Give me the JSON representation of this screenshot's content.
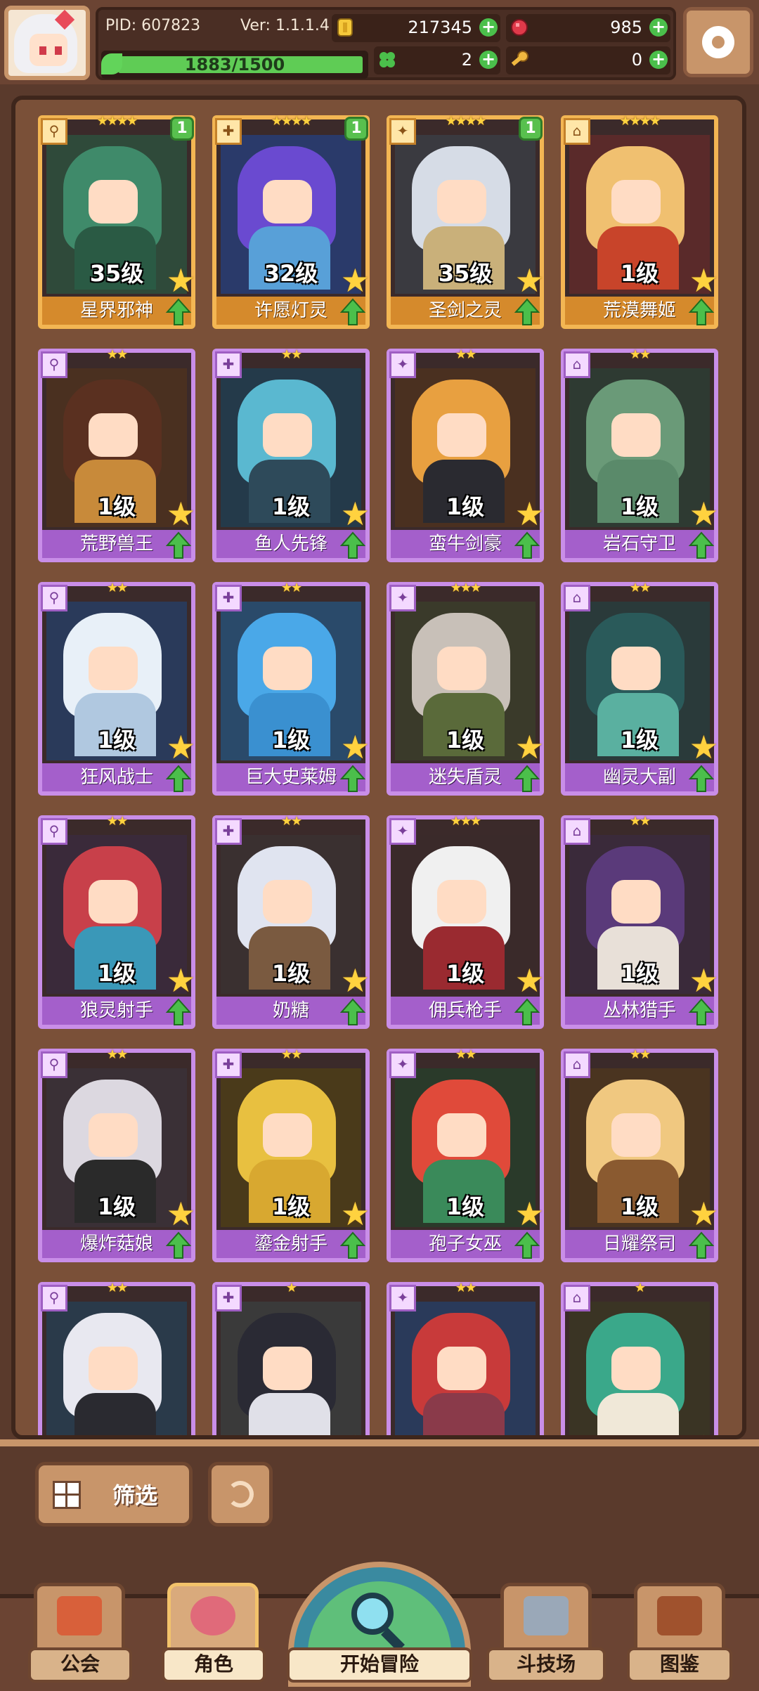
{
  "header": {
    "pid": "PID: 607823",
    "version": "Ver: 1.1.1.4",
    "xp": "1883/1500",
    "gold": "217345",
    "gems": "985",
    "clovers": "2",
    "keys": "0"
  },
  "roster": [
    {
      "name": "星界邪神",
      "level": "35级",
      "stars": "★★★★",
      "rarity": "gold",
      "badge": "1",
      "colors": {
        "bg": "#2f4a3a",
        "hair": "#3f8a6a",
        "body": "#2a5a44"
      }
    },
    {
      "name": "许愿灯灵",
      "level": "32级",
      "stars": "★★★★",
      "rarity": "gold",
      "badge": "1",
      "colors": {
        "bg": "#2a3a6a",
        "hair": "#6a4ad0",
        "body": "#58a0d8"
      }
    },
    {
      "name": "圣剑之灵",
      "level": "35级",
      "stars": "★★★★",
      "rarity": "gold",
      "badge": "1",
      "colors": {
        "bg": "#3a3a40",
        "hair": "#d6dce6",
        "body": "#c9b07a"
      }
    },
    {
      "name": "荒漠舞姬",
      "level": "1级",
      "stars": "★★★★",
      "rarity": "gold",
      "badge": "",
      "colors": {
        "bg": "#5a2a2a",
        "hair": "#f0c070",
        "body": "#c8442a"
      }
    },
    {
      "name": "荒野兽王",
      "level": "1级",
      "stars": "★★",
      "rarity": "purple",
      "badge": "",
      "colors": {
        "bg": "#4a3020",
        "hair": "#5a3020",
        "body": "#c88a3a"
      }
    },
    {
      "name": "鱼人先锋",
      "level": "1级",
      "stars": "★★",
      "rarity": "purple",
      "badge": "",
      "colors": {
        "bg": "#243a4a",
        "hair": "#5ab8d0",
        "body": "#2e4a5a"
      }
    },
    {
      "name": "蛮牛剑豪",
      "level": "1级",
      "stars": "★★",
      "rarity": "purple",
      "badge": "",
      "colors": {
        "bg": "#4a3020",
        "hair": "#e8a040",
        "body": "#2a2a30"
      }
    },
    {
      "name": "岩石守卫",
      "level": "1级",
      "stars": "★★",
      "rarity": "purple",
      "badge": "",
      "colors": {
        "bg": "#2e3a32",
        "hair": "#6a9a78",
        "body": "#5a8a6a"
      }
    },
    {
      "name": "狂风战士",
      "level": "1级",
      "stars": "★★",
      "rarity": "purple",
      "badge": "",
      "colors": {
        "bg": "#2a3a5a",
        "hair": "#e8f0f8",
        "body": "#b0c8e0"
      }
    },
    {
      "name": "巨大史莱姆",
      "level": "1级",
      "stars": "★★",
      "rarity": "purple",
      "badge": "",
      "colors": {
        "bg": "#2a4a6a",
        "hair": "#4aa8e8",
        "body": "#3a90d0"
      }
    },
    {
      "name": "迷失盾灵",
      "level": "1级",
      "stars": "★★★",
      "rarity": "purple",
      "badge": "",
      "colors": {
        "bg": "#3a3a2a",
        "hair": "#c8c0b8",
        "body": "#5a6a3a"
      }
    },
    {
      "name": "幽灵大副",
      "level": "1级",
      "stars": "★★",
      "rarity": "purple",
      "badge": "",
      "colors": {
        "bg": "#2a3a3a",
        "hair": "#2a5a5a",
        "body": "#5ab0a0"
      }
    },
    {
      "name": "狼灵射手",
      "level": "1级",
      "stars": "★★",
      "rarity": "purple",
      "badge": "",
      "colors": {
        "bg": "#3a2a3a",
        "hair": "#c8404a",
        "body": "#3a98b8"
      }
    },
    {
      "name": "奶糖",
      "level": "1级",
      "stars": "★★",
      "rarity": "purple",
      "badge": "",
      "colors": {
        "bg": "#3a3030",
        "hair": "#e0e4f0",
        "body": "#7a5a40"
      }
    },
    {
      "name": "佣兵枪手",
      "level": "1级",
      "stars": "★★★",
      "rarity": "purple",
      "badge": "",
      "colors": {
        "bg": "#3a2a2a",
        "hair": "#f0f0f0",
        "body": "#9a2a30"
      }
    },
    {
      "name": "丛林猎手",
      "level": "1级",
      "stars": "★★",
      "rarity": "purple",
      "badge": "",
      "colors": {
        "bg": "#3a2a3a",
        "hair": "#5a3a7a",
        "body": "#e8e0d8"
      }
    },
    {
      "name": "爆炸菇娘",
      "level": "1级",
      "stars": "★★",
      "rarity": "purple",
      "badge": "",
      "colors": {
        "bg": "#3a3036",
        "hair": "#dcd8e0",
        "body": "#2a2a2a"
      }
    },
    {
      "name": "鎏金射手",
      "level": "1级",
      "stars": "★★",
      "rarity": "purple",
      "badge": "",
      "colors": {
        "bg": "#4a3a1a",
        "hair": "#e8c040",
        "body": "#d8a830"
      }
    },
    {
      "name": "孢子女巫",
      "level": "1级",
      "stars": "★★",
      "rarity": "purple",
      "badge": "",
      "colors": {
        "bg": "#2a3a2a",
        "hair": "#e04a3a",
        "body": "#3a8a5a"
      }
    },
    {
      "name": "日耀祭司",
      "level": "1级",
      "stars": "★★",
      "rarity": "purple",
      "badge": "",
      "colors": {
        "bg": "#4a3420",
        "hair": "#f0c880",
        "body": "#8a5a30"
      }
    },
    {
      "name": "",
      "level": "",
      "stars": "★★",
      "rarity": "purple",
      "badge": "",
      "colors": {
        "bg": "#2a3a4a",
        "hair": "#e8e8f0",
        "body": "#2a2a30"
      }
    },
    {
      "name": "",
      "level": "",
      "stars": "★",
      "rarity": "purple",
      "badge": "",
      "colors": {
        "bg": "#3a3a3a",
        "hair": "#2a2a34",
        "body": "#e0e0e8"
      }
    },
    {
      "name": "",
      "level": "",
      "stars": "★★",
      "rarity": "purple",
      "badge": "",
      "colors": {
        "bg": "#2a3a5a",
        "hair": "#c83a3a",
        "body": "#8a3a4a"
      }
    },
    {
      "name": "",
      "level": "",
      "stars": "★",
      "rarity": "purple",
      "badge": "",
      "colors": {
        "bg": "#3a3424",
        "hair": "#3aa88a",
        "body": "#f0e8d8"
      }
    }
  ],
  "controls": {
    "filter_label": "筛选"
  },
  "nav": {
    "guild": "公会",
    "character": "角色",
    "adventure": "开始冒险",
    "arena": "斗技场",
    "codex": "图鉴"
  },
  "colors": {
    "gold_frame": "#f3b653",
    "purple_frame": "#c98ee8",
    "plus_green": "#4bbf4b"
  }
}
